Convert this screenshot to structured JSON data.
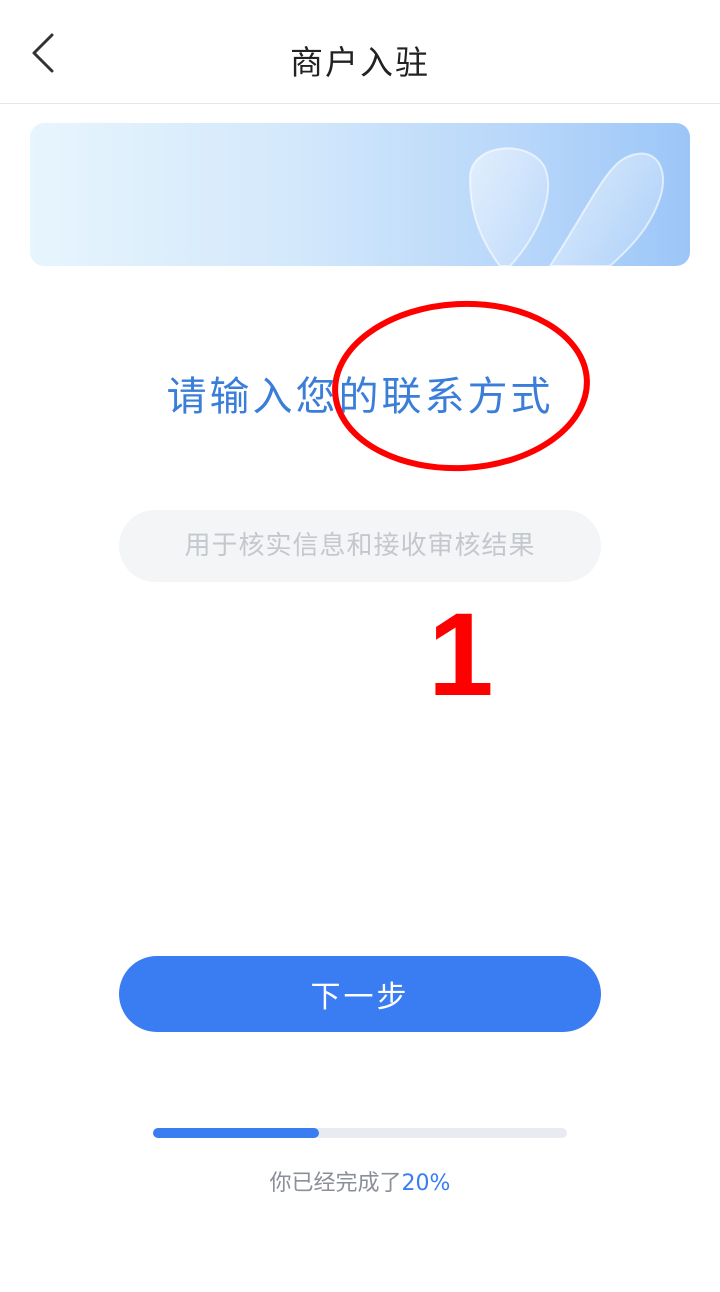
{
  "header": {
    "title": "商户入驻",
    "back_icon": "chevron-left-icon"
  },
  "banner": {
    "colors": [
      "#e7f5fd",
      "#9cc6f7"
    ]
  },
  "main": {
    "heading": "请输入您的联系方式",
    "contact_input": {
      "value": "",
      "placeholder": "用于核实信息和接收审核结果"
    },
    "next_button_label": "下一步"
  },
  "annotation": {
    "marker_text": "1",
    "color": "#ff0000"
  },
  "progress": {
    "prefix": "你已经完成了",
    "percent_label": "20%",
    "fraction": 0.4
  },
  "colors": {
    "accent": "#3a7df2",
    "heading": "#3a7ed9",
    "annotation": "#ff0000"
  }
}
